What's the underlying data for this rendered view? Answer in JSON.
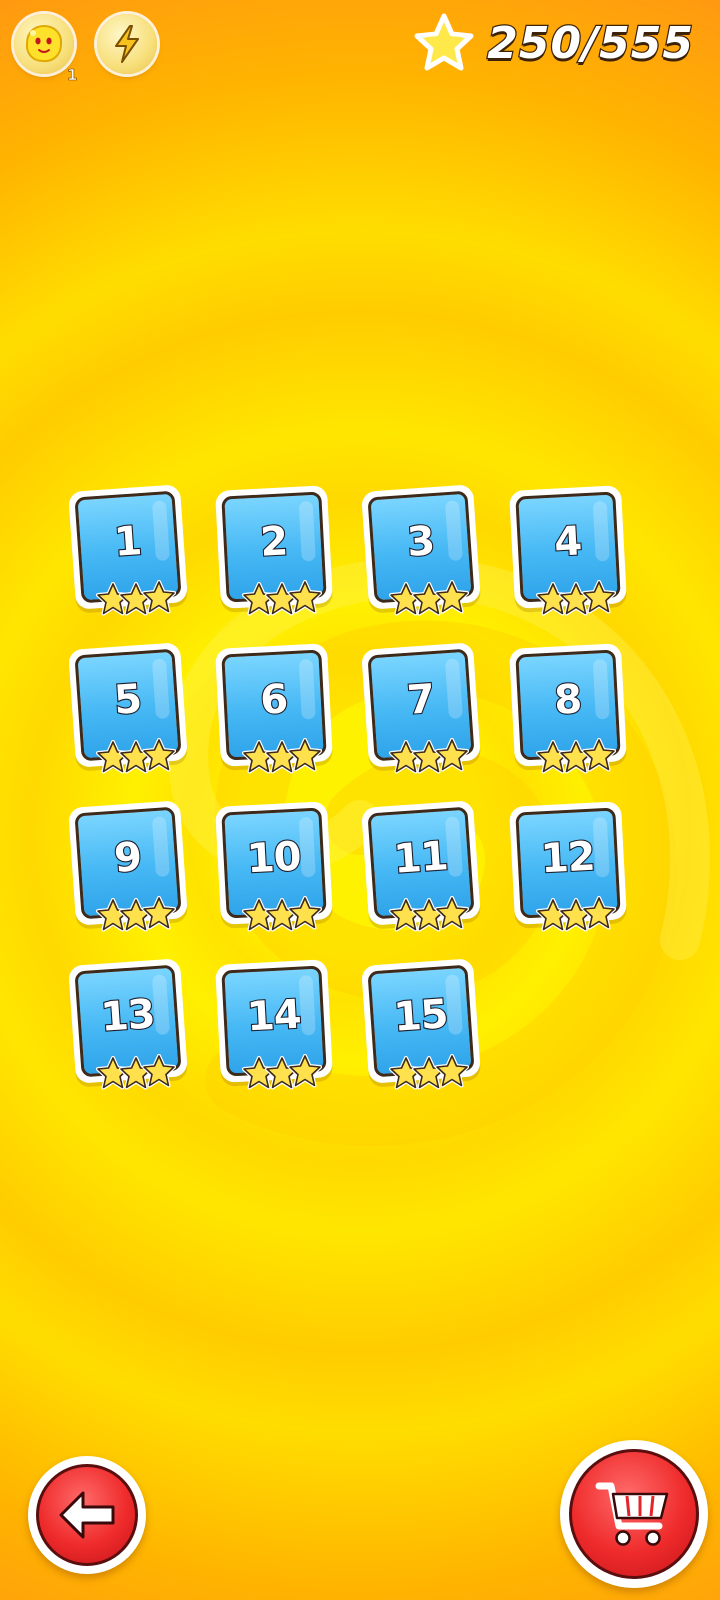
{
  "topbar": {
    "character_icon": "yellow-blob-character-icon",
    "character_count": "1",
    "power_icon": "lightning-bolt-icon",
    "stars_icon": "star-icon",
    "stars_total": "250/555"
  },
  "levels": [
    {
      "number": "1",
      "stars": 3
    },
    {
      "number": "2",
      "stars": 3
    },
    {
      "number": "3",
      "stars": 3
    },
    {
      "number": "4",
      "stars": 3
    },
    {
      "number": "5",
      "stars": 3
    },
    {
      "number": "6",
      "stars": 3
    },
    {
      "number": "7",
      "stars": 3
    },
    {
      "number": "8",
      "stars": 3
    },
    {
      "number": "9",
      "stars": 3
    },
    {
      "number": "10",
      "stars": 3
    },
    {
      "number": "11",
      "stars": 3
    },
    {
      "number": "12",
      "stars": 3
    },
    {
      "number": "13",
      "stars": 3
    },
    {
      "number": "14",
      "stars": 3
    },
    {
      "number": "15",
      "stars": 3
    }
  ],
  "bottom": {
    "back_icon": "arrow-left-icon",
    "shop_icon": "shopping-cart-icon"
  },
  "colors": {
    "background": "#ffe600",
    "tile": "#46b8f4",
    "star": "#ffe14d",
    "button": "#ef2b2b"
  }
}
